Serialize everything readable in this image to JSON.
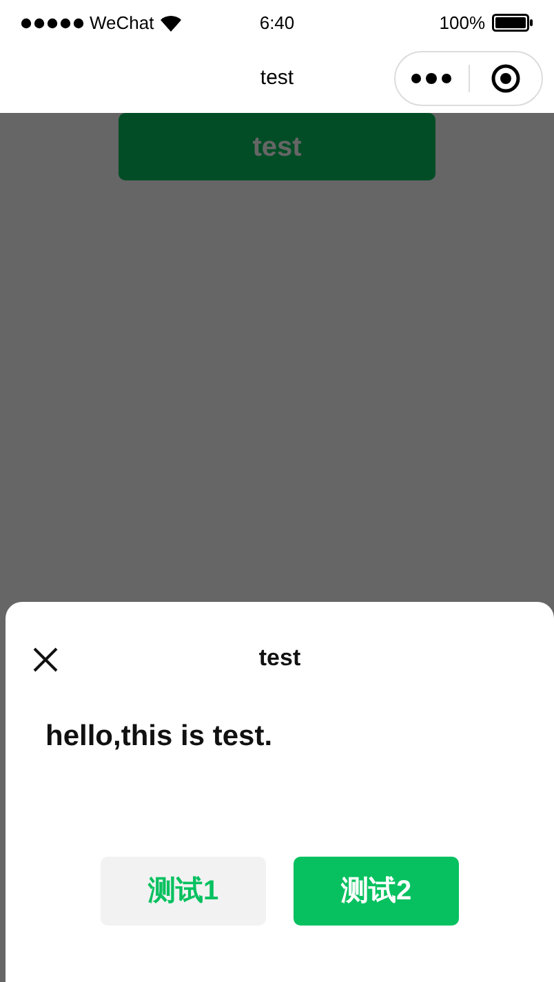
{
  "status_bar": {
    "carrier": "WeChat",
    "time": "6:40",
    "battery": "100%"
  },
  "nav_bar": {
    "title": "test"
  },
  "page": {
    "button": "test"
  },
  "sheet": {
    "title": "test",
    "message": "hello,this is test.",
    "buttons": [
      {
        "label": "测试1",
        "kind": "secondary"
      },
      {
        "label": "测试2",
        "kind": "primary"
      }
    ]
  }
}
